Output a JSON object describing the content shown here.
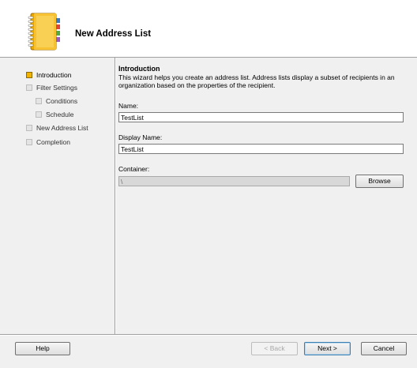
{
  "wizard": {
    "title": "New Address List"
  },
  "nav": {
    "items": [
      {
        "label": "Introduction",
        "active": true
      },
      {
        "label": "Filter Settings"
      },
      {
        "label": "Conditions"
      },
      {
        "label": "Schedule"
      },
      {
        "label": "New Address List"
      },
      {
        "label": "Completion"
      }
    ]
  },
  "content": {
    "section_title": "Introduction",
    "description": "This wizard helps you create an address list. Address lists display a subset of recipients in an organization based on the properties of the recipient.",
    "name": {
      "label": "Name:",
      "value": "TestList"
    },
    "display_name": {
      "label": "Display Name:",
      "value": "TestList"
    },
    "container": {
      "label": "Container:",
      "value": "\\"
    },
    "browse_label": "Browse"
  },
  "footer": {
    "help_label": "Help",
    "back_label": "< Back",
    "next_label": "Next >",
    "cancel_label": "Cancel"
  },
  "icons": {
    "header": "address-book-icon"
  },
  "colors": {
    "active_step": "#f2b200",
    "book_cover": "#f0b400"
  }
}
